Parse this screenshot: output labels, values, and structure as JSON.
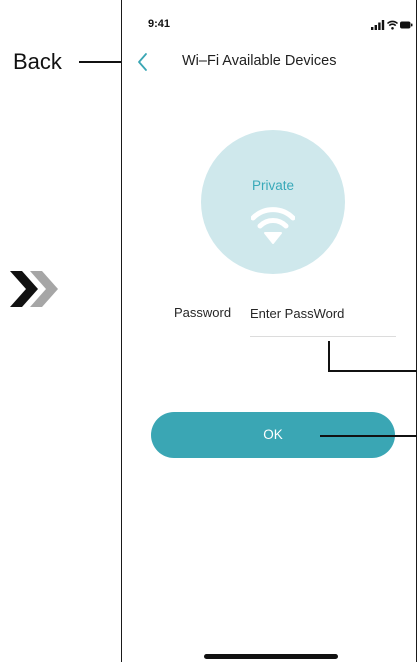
{
  "annotation": {
    "back_label": "Back"
  },
  "status_bar": {
    "time": "9:41"
  },
  "nav": {
    "title": "Wi–Fi Available Devices"
  },
  "network": {
    "name": "Private"
  },
  "password": {
    "label": "Password",
    "placeholder": "Enter PassWord",
    "value": ""
  },
  "actions": {
    "ok_label": "OK"
  },
  "colors": {
    "accent": "#3aa6b4",
    "circle": "#cfe8ec",
    "network_text": "#39a9b9"
  },
  "icons": [
    "back-chevron-icon",
    "wifi-icon",
    "signal-icon",
    "battery-icon",
    "double-chevron-right-icon"
  ]
}
